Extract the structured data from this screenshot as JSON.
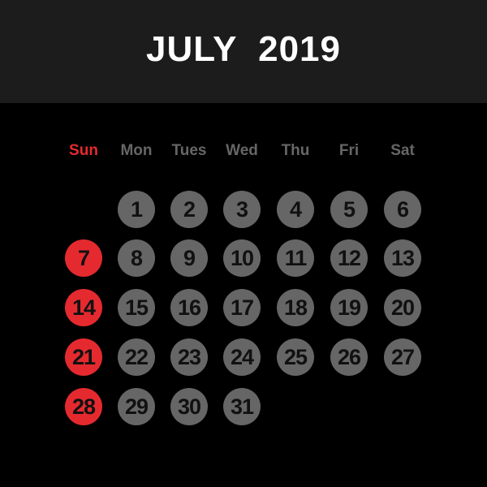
{
  "calendar": {
    "title": "JULY  2019",
    "month": "JULY",
    "year": "2019",
    "colors": {
      "header_bg": "#1c1c1c",
      "background": "#000000",
      "title": "#ffffff",
      "weekday": "#666666",
      "sunday_accent": "#e52a2f",
      "day_circle": "#666666",
      "day_number": "#111111"
    },
    "weekdays": [
      "Sun",
      "Mon",
      "Tues",
      "Wed",
      "Thu",
      "Fri",
      "Sat"
    ],
    "first_weekday_index": 1,
    "days_in_month": 31,
    "weeks": [
      [
        "",
        "1",
        "2",
        "3",
        "4",
        "5",
        "6"
      ],
      [
        "7",
        "8",
        "9",
        "10",
        "11",
        "12",
        "13"
      ],
      [
        "14",
        "15",
        "16",
        "17",
        "18",
        "19",
        "20"
      ],
      [
        "21",
        "22",
        "23",
        "24",
        "25",
        "26",
        "27"
      ],
      [
        "28",
        "29",
        "30",
        "31",
        "",
        "",
        ""
      ]
    ]
  }
}
